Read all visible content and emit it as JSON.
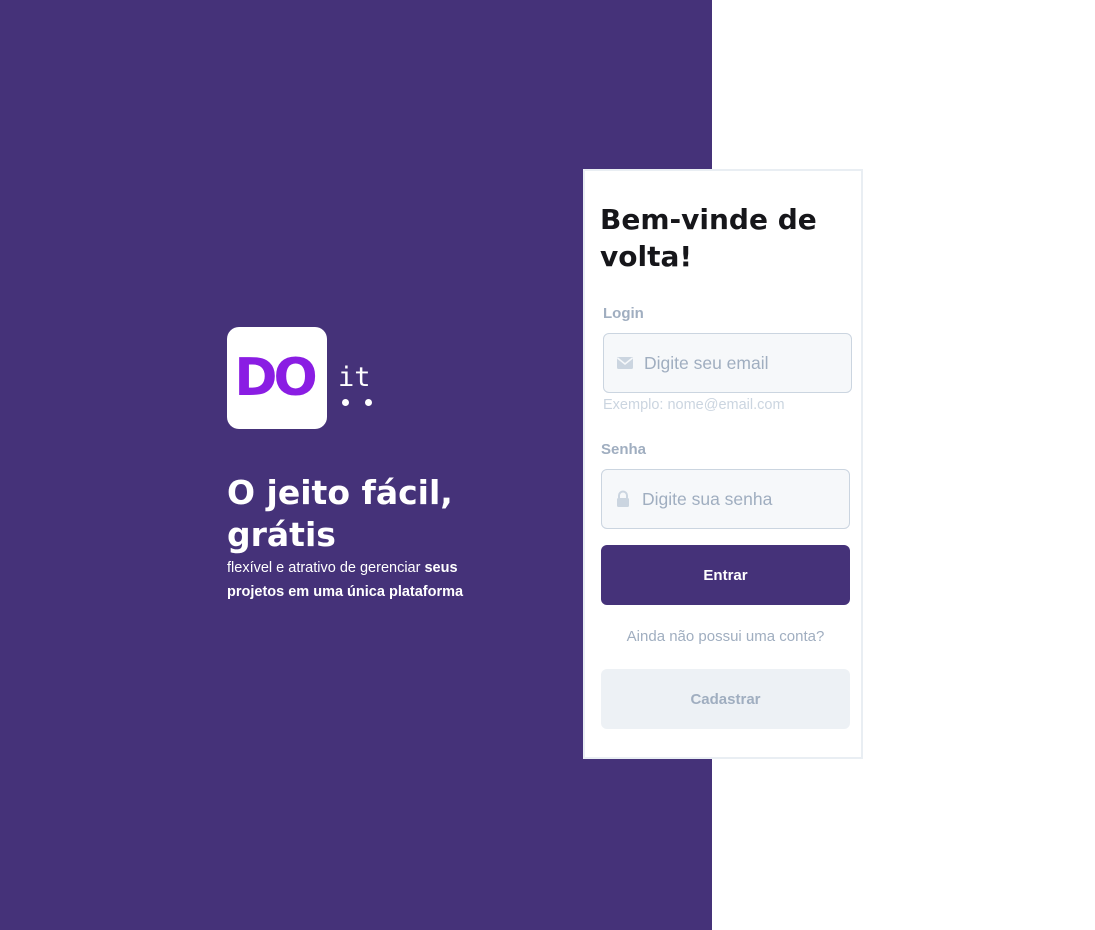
{
  "brand": {
    "logo_text": "DO",
    "logo_suffix": "it",
    "primary_color": "#453279",
    "logo_color": "#8a1de3"
  },
  "hero": {
    "title": "O jeito fácil, grátis",
    "subtitle_plain": "flexível e atrativo de gerenciar ",
    "subtitle_bold": "seus projetos em uma única plataforma"
  },
  "login_form": {
    "title": "Bem-vinde de volta!",
    "email_label": "Login",
    "email_placeholder": "Digite seu email",
    "email_icon": "envelope-icon",
    "email_hint": "Exemplo: nome@email.com",
    "password_label": "Senha",
    "password_placeholder": "Digite sua senha",
    "password_icon": "lock-icon",
    "submit_label": "Entrar",
    "signup_question": "Ainda não possui uma conta?",
    "signup_label": "Cadastrar"
  }
}
